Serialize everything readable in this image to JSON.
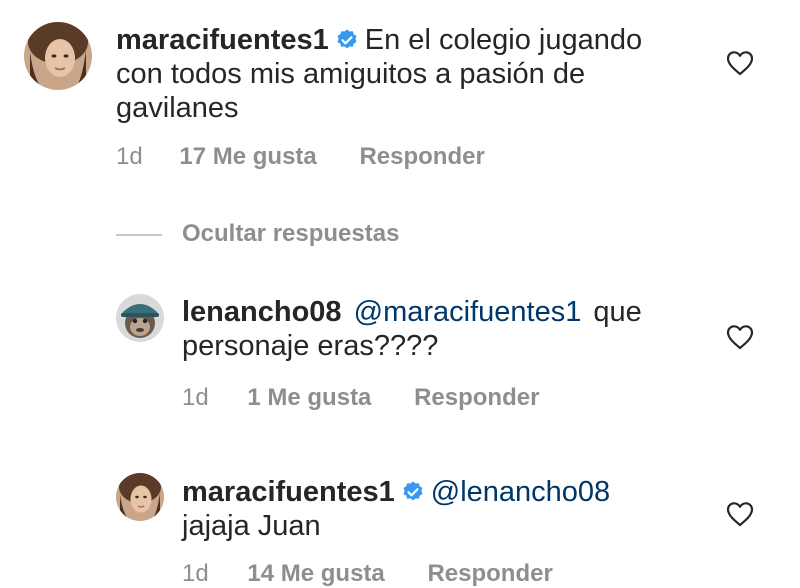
{
  "comments": [
    {
      "username": "maracifuentes1",
      "verified": true,
      "mention": "",
      "text_line1": "En el colegio jugando",
      "text_line2": "con todos mis amiguitos a pasión de",
      "text_line3": "gavilanes",
      "time": "1d",
      "likes": "17 Me gusta",
      "reply": "Responder",
      "avatar_icon": "avatar-woman-photo",
      "like_icon": "heart-outline-icon"
    },
    {
      "username": "lenancho08",
      "verified": false,
      "mention": "@maracifuentes1",
      "text_line1": "que",
      "text_line2": "personaje eras????",
      "time": "1d",
      "likes": "1 Me gusta",
      "reply": "Responder",
      "avatar_icon": "avatar-monkey-cap",
      "like_icon": "heart-outline-icon"
    },
    {
      "username": "maracifuentes1",
      "verified": true,
      "mention": "@lenancho08",
      "text_line1": "",
      "text_line2": "jajaja Juan",
      "time": "1d",
      "likes": "14 Me gusta",
      "reply": "Responder",
      "avatar_icon": "avatar-woman-photo",
      "like_icon": "heart-outline-icon"
    }
  ],
  "replies_toggle": {
    "label": "Ocultar respuestas"
  },
  "colors": {
    "text": "#262626",
    "muted": "#8e8e8e",
    "mention": "#00376b",
    "verified": "#3897f0"
  }
}
